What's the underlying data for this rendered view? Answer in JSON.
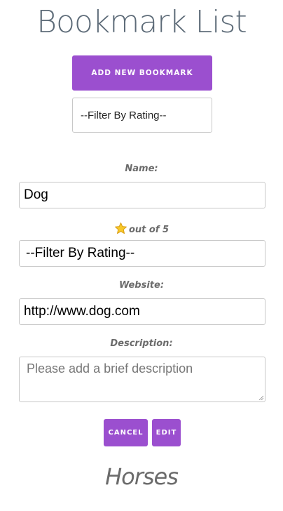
{
  "header": {
    "title": "Bookmark List",
    "add_button_label": "ADD NEW BOOKMARK",
    "filter_selected": "--Filter By Rating--"
  },
  "form": {
    "name_label": "Name:",
    "name_value": "Dog",
    "rating_label": "out of 5",
    "rating_selected": "--Filter By Rating--",
    "website_label": "Website:",
    "website_value": "http://www.dog.com",
    "description_label": "Description:",
    "description_placeholder": "Please add a brief description",
    "cancel_label": "CANCEL",
    "edit_label": "EDIT"
  },
  "next_item": {
    "title": "Horses"
  },
  "colors": {
    "accent": "#9b4fcf",
    "title": "#5d6b78",
    "label": "#6b6b6b"
  },
  "icons": {
    "rating": "star-icon"
  }
}
